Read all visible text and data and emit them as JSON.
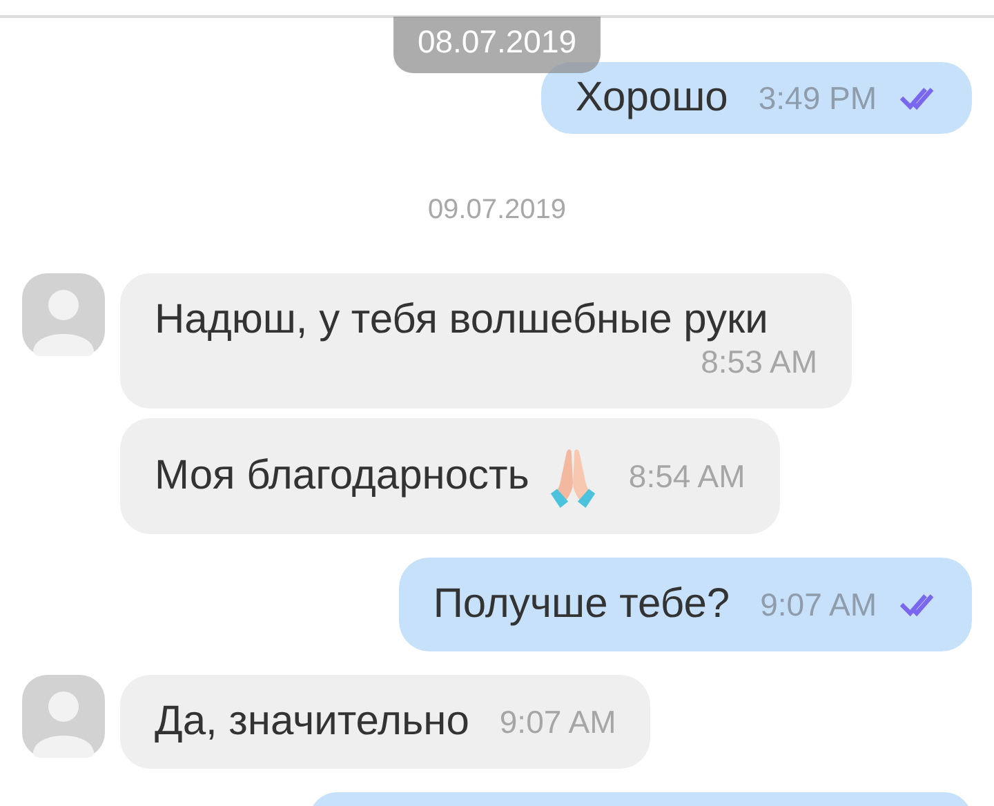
{
  "sticky_date": "08.07.2019",
  "items": [
    {
      "kind": "outgoing",
      "text": "Хорошо",
      "time": "3:49 PM",
      "read": true
    },
    {
      "kind": "date",
      "text": "09.07.2019"
    },
    {
      "kind": "incoming",
      "avatar": true,
      "text": "Надюш, у тебя волшебные руки",
      "time": "8:53 AM"
    },
    {
      "kind": "incoming",
      "avatar": false,
      "text": "Моя благодарность",
      "emoji": true,
      "time": "8:54 AM"
    },
    {
      "kind": "outgoing",
      "text": "Получше тебе?",
      "time": "9:07 AM",
      "read": true
    },
    {
      "kind": "incoming",
      "avatar": true,
      "text": "Да, значительно",
      "time": "9:07 AM"
    },
    {
      "kind": "outgoing_cut"
    }
  ]
}
